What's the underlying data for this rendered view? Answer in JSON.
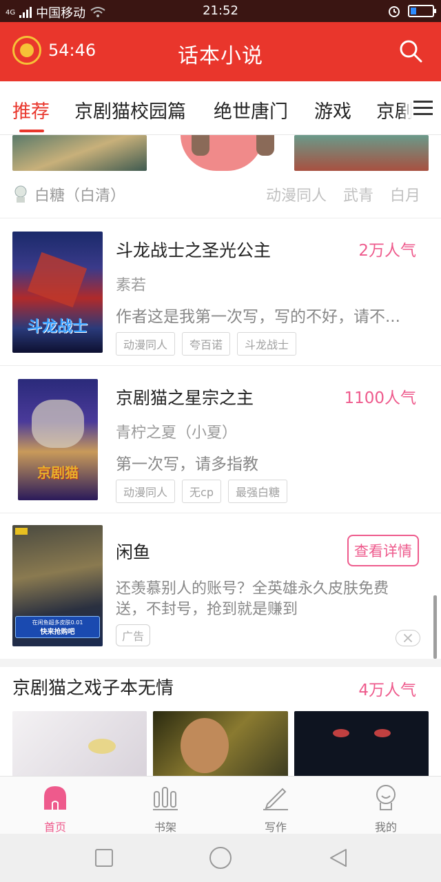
{
  "status_bar": {
    "network": "4G",
    "carrier": "中国移动",
    "time": "21:52"
  },
  "header": {
    "timer": "54:46",
    "title": "话本小说"
  },
  "tabs": [
    "推荐",
    "京剧猫校园篇",
    "绝世唐门",
    "游戏",
    "京剧"
  ],
  "prev_item": {
    "author": "白糖（白清）",
    "tags": [
      "动漫同人",
      "武青",
      "白月"
    ]
  },
  "books": [
    {
      "title": "斗龙战士之圣光公主",
      "popularity": "2万人气",
      "author": "素若",
      "description": "作者这是我第一次写，写的不好，请不...",
      "tags": [
        "动漫同人",
        "夸百诺",
        "斗龙战士"
      ],
      "cover_text": "斗龙战士"
    },
    {
      "title": "京剧猫之星宗之主",
      "popularity": "1100人气",
      "author": "青柠之夏（小夏）",
      "description": "第一次写，请多指教",
      "tags": [
        "动漫同人",
        "无cp",
        "最强白糖"
      ],
      "cover_text": "京剧猫"
    }
  ],
  "ad": {
    "title": "闲鱼",
    "detail_button": "查看详情",
    "description": "还羡慕别人的账号？全英雄永久皮肤免费送，不封号，抢到就是赚到",
    "label": "广告",
    "cover_line1": "在闲鱼超多皮肤0.01",
    "cover_line2": "快来抢购吧"
  },
  "next_section": {
    "title": "京剧猫之戏子本无情",
    "popularity": "4万人气"
  },
  "bottom_nav": [
    {
      "label": "首页",
      "icon": "home-icon",
      "active": true
    },
    {
      "label": "书架",
      "icon": "bookshelf-icon",
      "active": false
    },
    {
      "label": "写作",
      "icon": "pencil-icon",
      "active": false
    },
    {
      "label": "我的",
      "icon": "profile-icon",
      "active": false
    }
  ],
  "colors": {
    "brand_red": "#e9362c",
    "accent_pink": "#ee5a8c"
  }
}
